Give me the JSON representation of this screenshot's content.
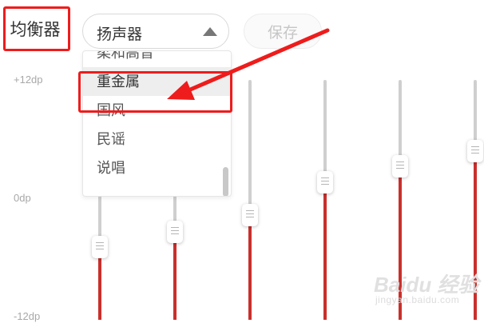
{
  "equalizer": {
    "title": "均衡器",
    "device_select": {
      "value": "扬声器",
      "caret_icon": "caret-up-icon"
    },
    "save_label": "保存",
    "presets": [
      {
        "label": "柔和高音",
        "selected": false
      },
      {
        "label": "重金属",
        "selected": true
      },
      {
        "label": "国风",
        "selected": false
      },
      {
        "label": "民谣",
        "selected": false
      },
      {
        "label": "说唱",
        "selected": false
      }
    ],
    "scale": {
      "max_label": "+12dp",
      "mid_label": "0dp",
      "min_label": "-12dp",
      "max": 12,
      "min": -12
    },
    "bands": [
      {
        "value": -4.7
      },
      {
        "value": -3.2
      },
      {
        "value": -1.5
      },
      {
        "value": 1.8
      },
      {
        "value": 3.4
      },
      {
        "value": 4.9
      }
    ]
  },
  "annotation": {
    "highlight_color": "#ee1c1c",
    "arrow_icon": "red-arrow"
  },
  "watermark": {
    "text": "Baidu 经验",
    "sub": "jingyan.baidu.com"
  },
  "colors": {
    "track": "#cfcfcf",
    "fill": "#c9302c",
    "text": "#333333",
    "muted": "#a8a8a8"
  }
}
